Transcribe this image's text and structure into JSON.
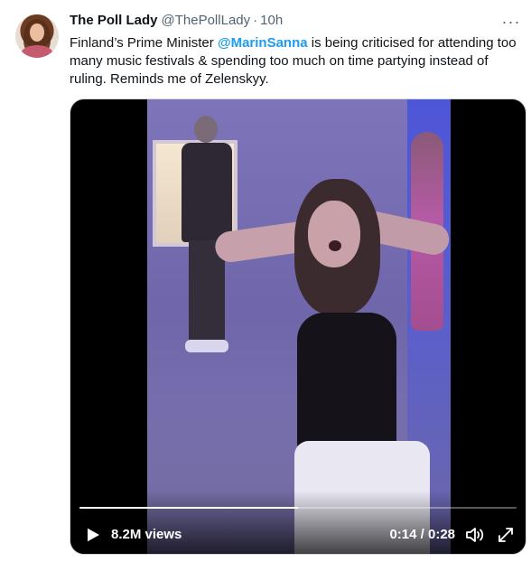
{
  "tweet": {
    "author": {
      "display_name": "The Poll Lady",
      "handle": "@ThePollLady",
      "separator": "·",
      "time": "10h"
    },
    "text_before": "Finland’s Prime Minister ",
    "mention": "@MarinSanna",
    "text_after": " is being criticised for attending too many music festivals & spending too much on time partying instead of ruling. Reminds me of Zelenskyy.",
    "more_label": "···"
  },
  "video": {
    "views": "8.2M views",
    "time": "0:14 / 0:28",
    "progress_fraction": 0.5
  },
  "icons": {
    "more": "more-icon",
    "play": "play-icon",
    "volume": "volume-icon",
    "fullscreen": "fullscreen-icon"
  },
  "colors": {
    "link": "#1d9bf0",
    "text": "#0f1419",
    "muted": "#536471"
  }
}
